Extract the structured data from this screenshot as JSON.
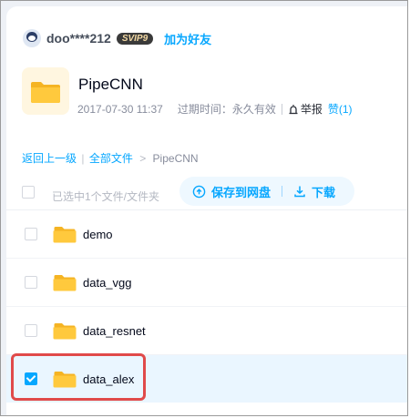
{
  "user": {
    "name": "doo****212",
    "vip_badge": "SVIP9",
    "add_friend": "加为好友"
  },
  "file": {
    "title": "PipeCNN",
    "date": "2017-07-30 11:37",
    "expire_label": "过期时间：永久有效",
    "report": "举报",
    "like": "赞(1)"
  },
  "breadcrumb": {
    "back": "返回上一级",
    "separator": "|",
    "all_files": "全部文件",
    "arrow": ">",
    "current": "PipeCNN"
  },
  "toolbar": {
    "selected_info": "已选中1个文件/文件夹",
    "save_label": "保存到网盘",
    "download_label": "下载"
  },
  "items": [
    {
      "name": "demo",
      "checked": false
    },
    {
      "name": "data_vgg",
      "checked": false
    },
    {
      "name": "data_resnet",
      "checked": false
    },
    {
      "name": "data_alex",
      "checked": true
    }
  ],
  "colors": {
    "accent": "#06a7ff",
    "folder": "#ffc93d",
    "highlight": "#e04a4a"
  }
}
